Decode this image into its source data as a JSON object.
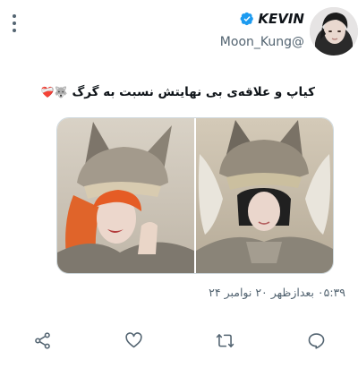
{
  "user": {
    "display_name": "KEVIN",
    "handle": "Moon_Kung@"
  },
  "tweet": {
    "text": "کیاپ و علاقه‌ی بی نهایتش نسبت به گرگ",
    "emoji": "🐺❤️‍🩹",
    "timestamp": "۰۵:۳۹ بعدازظهر ۲۰ نوامبر ۲۴"
  },
  "colors": {
    "accent": "#1d9bf0",
    "text_primary": "#0f1419",
    "text_secondary": "#536471",
    "border": "#cfd9de"
  },
  "icons": {
    "more": "more-vertical-icon",
    "verified": "verified-badge-icon",
    "share": "share-icon",
    "like": "heart-icon",
    "retweet": "retweet-icon",
    "reply": "reply-icon"
  }
}
